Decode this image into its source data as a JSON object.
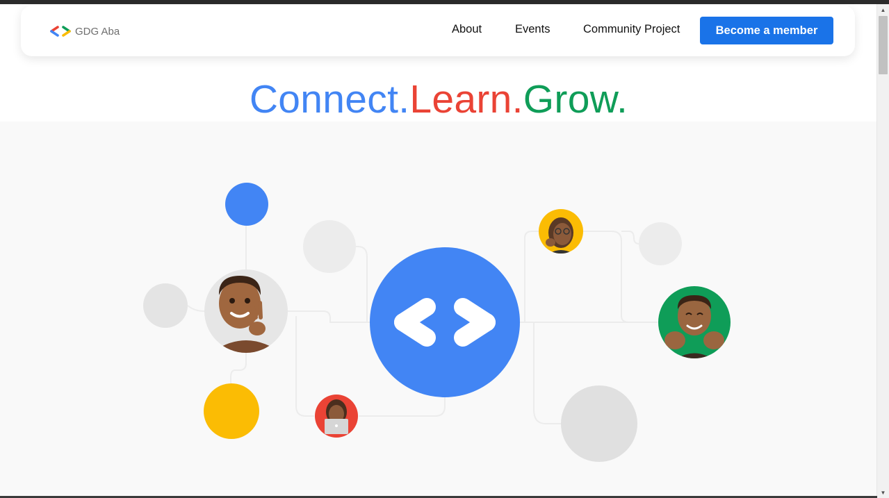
{
  "header": {
    "brand": {
      "name": "GDG Aba",
      "icon": "gdg-brackets-logo"
    },
    "nav": [
      {
        "label": "About"
      },
      {
        "label": "Events"
      },
      {
        "label": "Community Project"
      }
    ],
    "cta_label": "Become a member"
  },
  "hero": {
    "headline": [
      {
        "text": "Connect.",
        "color": "#4285f4"
      },
      {
        "text": "Learn.",
        "color": "#ea4335"
      },
      {
        "text": "Grow.",
        "color": "#0f9d58"
      }
    ],
    "illustration": {
      "center_icon": "code-brackets-icon",
      "avatars": [
        {
          "icon": "memoji-peace-sign-avatar",
          "background": "#e6e6e6"
        },
        {
          "icon": "memoji-glasses-avatar",
          "background": "#fbbc04"
        },
        {
          "icon": "memoji-waving-hands-avatar",
          "background": "#0f9d58"
        },
        {
          "icon": "memoji-laptop-avatar",
          "background": "#ea4335"
        }
      ],
      "accent_dots": [
        {
          "color": "#4285f4"
        },
        {
          "color": "#fbbc04"
        }
      ]
    }
  },
  "colors": {
    "brand_blue": "#4285f4",
    "brand_red": "#ea4335",
    "brand_yellow": "#fbbc04",
    "brand_green": "#0f9d58",
    "cta_blue": "#1a73e8"
  }
}
